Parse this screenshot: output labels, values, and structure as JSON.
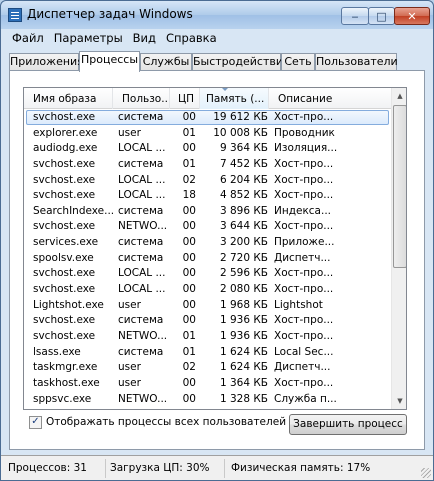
{
  "window": {
    "title": "Диспетчер задач Windows",
    "min_glyph": "‒",
    "max_glyph": "□",
    "close_glyph": "✕"
  },
  "menu": [
    "Файл",
    "Параметры",
    "Вид",
    "Справка"
  ],
  "tabs": [
    {
      "label": "Приложения",
      "active": false
    },
    {
      "label": "Процессы",
      "active": true
    },
    {
      "label": "Службы",
      "active": false
    },
    {
      "label": "Быстродействие",
      "active": false
    },
    {
      "label": "Сеть",
      "active": false
    },
    {
      "label": "Пользователи",
      "active": false
    }
  ],
  "table": {
    "columns": {
      "name": "Имя образа",
      "user": "Пользо...",
      "cpu": "ЦП",
      "mem": "Память (...",
      "desc": "Описание"
    },
    "rows": [
      {
        "name": "svchost.exe",
        "user": "система",
        "cpu": "00",
        "mem": "19 612 КБ",
        "desc": "Хост-про...",
        "selected": true
      },
      {
        "name": "explorer.exe",
        "user": "user",
        "cpu": "01",
        "mem": "10 008 КБ",
        "desc": "Проводник"
      },
      {
        "name": "audiodg.exe",
        "user": "LOCAL ...",
        "cpu": "00",
        "mem": "9 364 КБ",
        "desc": "Изоляция..."
      },
      {
        "name": "svchost.exe",
        "user": "система",
        "cpu": "01",
        "mem": "7 452 КБ",
        "desc": "Хост-про..."
      },
      {
        "name": "svchost.exe",
        "user": "LOCAL ...",
        "cpu": "02",
        "mem": "6 204 КБ",
        "desc": "Хост-про..."
      },
      {
        "name": "svchost.exe",
        "user": "LOCAL ...",
        "cpu": "18",
        "mem": "4 852 КБ",
        "desc": "Хост-про..."
      },
      {
        "name": "SearchIndexe...",
        "user": "система",
        "cpu": "00",
        "mem": "3 896 КБ",
        "desc": "Индекса..."
      },
      {
        "name": "svchost.exe",
        "user": "NETWO...",
        "cpu": "00",
        "mem": "3 644 КБ",
        "desc": "Хост-про..."
      },
      {
        "name": "services.exe",
        "user": "система",
        "cpu": "00",
        "mem": "3 200 КБ",
        "desc": "Приложе..."
      },
      {
        "name": "spoolsv.exe",
        "user": "система",
        "cpu": "00",
        "mem": "2 720 КБ",
        "desc": "Диспетч..."
      },
      {
        "name": "svchost.exe",
        "user": "LOCAL ...",
        "cpu": "00",
        "mem": "2 596 КБ",
        "desc": "Хост-про..."
      },
      {
        "name": "svchost.exe",
        "user": "LOCAL ...",
        "cpu": "00",
        "mem": "2 080 КБ",
        "desc": "Хост-про..."
      },
      {
        "name": "Lightshot.exe",
        "user": "user",
        "cpu": "00",
        "mem": "1 968 КБ",
        "desc": "Lightshot"
      },
      {
        "name": "svchost.exe",
        "user": "система",
        "cpu": "00",
        "mem": "1 936 КБ",
        "desc": "Хост-про..."
      },
      {
        "name": "svchost.exe",
        "user": "NETWO...",
        "cpu": "01",
        "mem": "1 936 КБ",
        "desc": "Хост-про..."
      },
      {
        "name": "lsass.exe",
        "user": "система",
        "cpu": "01",
        "mem": "1 624 КБ",
        "desc": "Local Sec..."
      },
      {
        "name": "taskmgr.exe",
        "user": "user",
        "cpu": "02",
        "mem": "1 624 КБ",
        "desc": "Диспетч..."
      },
      {
        "name": "taskhost.exe",
        "user": "user",
        "cpu": "00",
        "mem": "1 364 КБ",
        "desc": "Хост-про..."
      },
      {
        "name": "sppsvc.exe",
        "user": "NETWO...",
        "cpu": "00",
        "mem": "1 328 КБ",
        "desc": "Служба п..."
      }
    ]
  },
  "show_all_users": {
    "label": "Отображать процессы всех пользователей",
    "checked": true,
    "check_glyph": "✓"
  },
  "end_process_button": "Завершить процесс",
  "status": {
    "processes": "Процессов: 31",
    "cpu": "Загрузка ЦП: 30%",
    "memory": "Физическая память: 17%"
  },
  "scroll_glyphs": {
    "up": "▲",
    "down": "▼"
  }
}
